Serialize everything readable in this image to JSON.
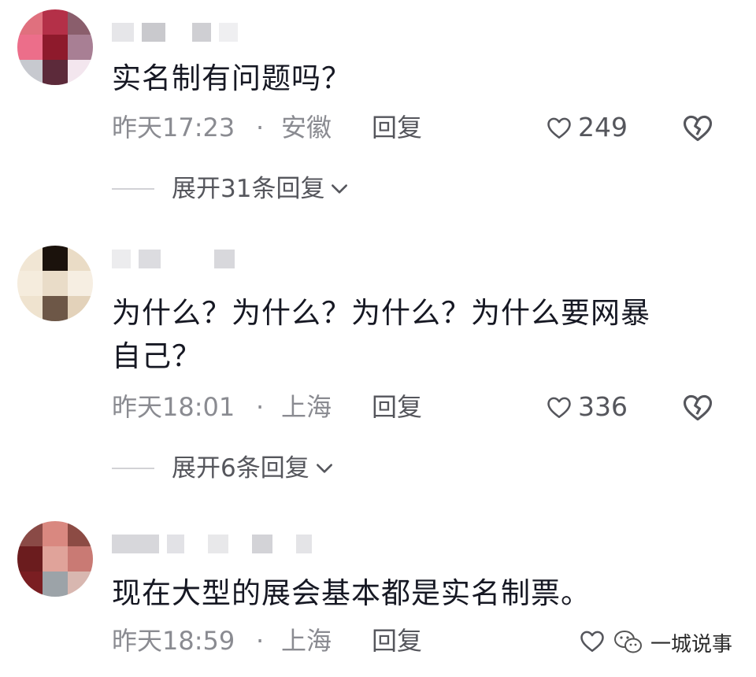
{
  "comments": [
    {
      "text": "实名制有问题吗？",
      "time": "昨天17:23",
      "separator": "·",
      "location": "安徽",
      "reply_label": "回复",
      "likes": "249",
      "expand_label": "展开31条回复"
    },
    {
      "text": "为什么？为什么？为什么？为什么要网暴\n自己？",
      "time": "昨天18:01",
      "separator": "·",
      "location": "上海",
      "reply_label": "回复",
      "likes": "336",
      "expand_label": "展开6条回复"
    },
    {
      "text": "现在大型的展会基本都是实名制票。",
      "time": "昨天18:59",
      "separator": "·",
      "location": "上海",
      "reply_label": "回复"
    }
  ],
  "watermark": {
    "text": "一城说事",
    "icon": "wechat-icon"
  },
  "icons": {
    "like": "heart-outline-icon",
    "dislike": "broken-heart-icon",
    "expand": "chevron-down-icon"
  },
  "colors": {
    "text": "#161823",
    "meta": "#8a8b91",
    "action": "#55565c",
    "divider": "#d2d2d6"
  }
}
